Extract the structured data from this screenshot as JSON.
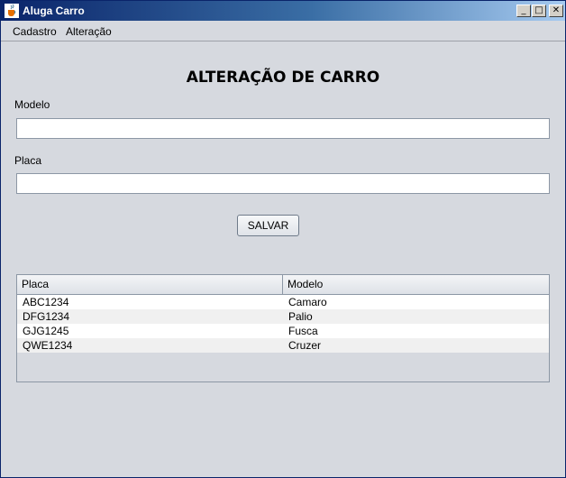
{
  "window": {
    "title": "Aluga Carro",
    "minimize": "_",
    "maximize": "□",
    "close": "✕"
  },
  "menu": {
    "items": [
      "Cadastro",
      "Alteração"
    ]
  },
  "form": {
    "heading": "ALTERAÇÃO DE CARRO",
    "modelo_label": "Modelo",
    "modelo_value": "",
    "placa_label": "Placa",
    "placa_value": "",
    "save_label": "SALVAR"
  },
  "table": {
    "headers": [
      "Placa",
      "Modelo"
    ],
    "rows": [
      [
        "ABC1234",
        "Camaro"
      ],
      [
        "DFG1234",
        "Palio"
      ],
      [
        "GJG1245",
        "Fusca"
      ],
      [
        "QWE1234",
        "Cruzer"
      ]
    ]
  }
}
